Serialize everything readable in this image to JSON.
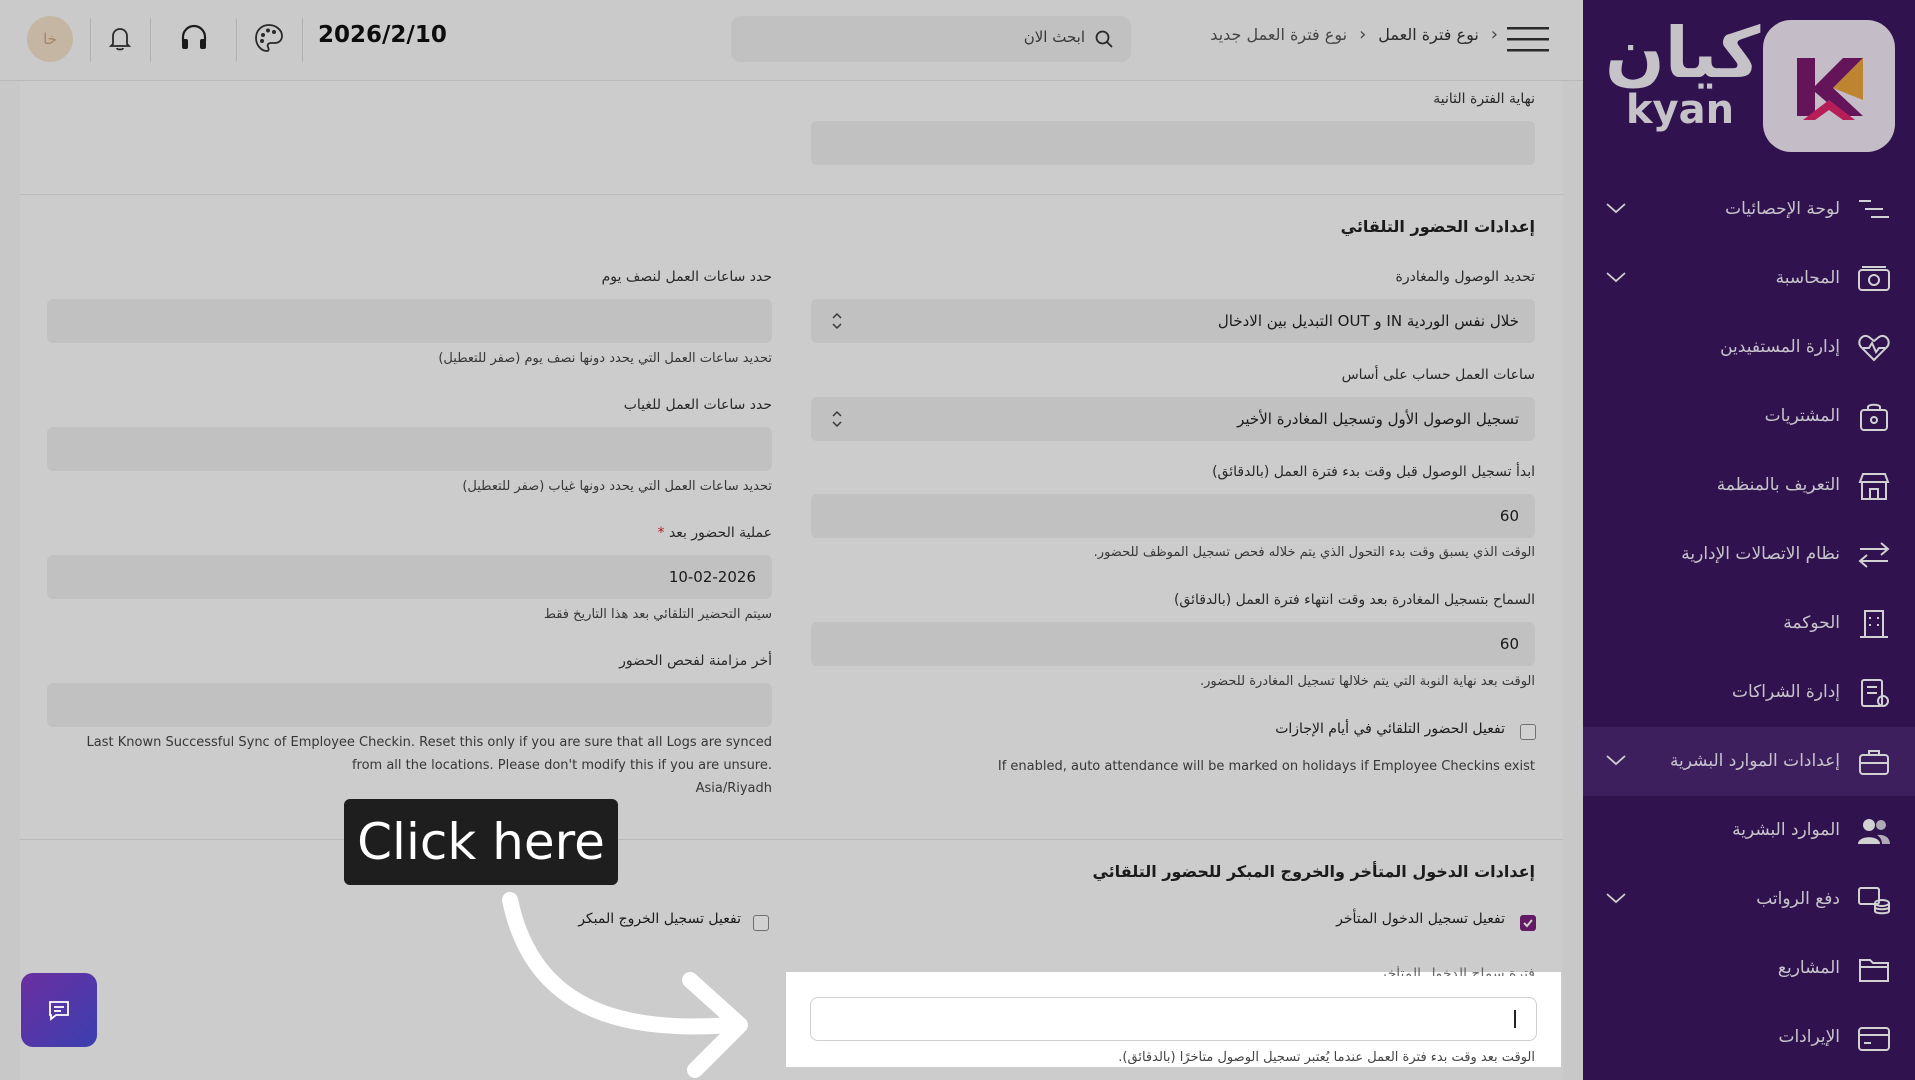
{
  "sidebar": {
    "logo": {
      "arabic": "كيان",
      "english": "kyan"
    },
    "items": [
      {
        "label": "لوحة الإحصائيات",
        "icon": "stats-icon",
        "has_chevron": true
      },
      {
        "label": "المحاسبة",
        "icon": "money-icon",
        "has_chevron": true
      },
      {
        "label": "إدارة المستفيدين",
        "icon": "heart-pulse-icon",
        "has_chevron": false
      },
      {
        "label": "المشتريات",
        "icon": "purchase-box-icon",
        "has_chevron": false
      },
      {
        "label": "التعريف بالمنظمة",
        "icon": "store-icon",
        "has_chevron": false
      },
      {
        "label": "نظام الاتصالات الإدارية",
        "icon": "arrows-exchange-icon",
        "has_chevron": false
      },
      {
        "label": "الحوكمة",
        "icon": "building-icon",
        "has_chevron": false
      },
      {
        "label": "إدارة الشراكات",
        "icon": "document-icon",
        "has_chevron": false
      },
      {
        "label": "إعدادات الموارد البشرية",
        "icon": "briefcase-icon",
        "has_chevron": true,
        "active": true
      },
      {
        "label": "الموارد البشرية",
        "icon": "users-icon",
        "has_chevron": false
      },
      {
        "label": "دفع الرواتب",
        "icon": "coins-icon",
        "has_chevron": true
      },
      {
        "label": "المشاريع",
        "icon": "folder-icon",
        "has_chevron": false
      },
      {
        "label": "الإيرادات",
        "icon": "card-icon",
        "has_chevron": false
      }
    ]
  },
  "header": {
    "breadcrumb": [
      "نوع فترة العمل",
      "نوع فترة العمل جديد"
    ],
    "search_placeholder": "ابحث الان",
    "date": "2026/2/10",
    "avatar_initials": "خا"
  },
  "form": {
    "second_period_end_label": "نهاية الفترة الثانية",
    "auto_attendance_title": "إعدادات الحضور التلقائي",
    "determine_in_out_label": "تحديد الوصول والمغادرة",
    "determine_in_out_value": "خلال نفس الوردية IN و OUT التبديل بين الادخال",
    "working_hours_basis_label": "ساعات العمل حساب على أساس",
    "working_hours_basis_value": "تسجيل الوصول الأول وتسجيل المغادرة الأخير",
    "checkin_before_label": "ابدأ تسجيل الوصول قبل وقت بدء فترة العمل (بالدقائق)",
    "checkin_before_value": "60",
    "checkin_before_hint": "الوقت الذي يسبق وقت بدء التحول الذي يتم خلاله فحص تسجيل الموظف للحضور.",
    "checkout_after_label": "السماح بتسجيل المغادرة بعد وقت انتهاء فترة العمل (بالدقائق)",
    "checkout_after_value": "60",
    "checkout_after_hint": "الوقت بعد نهاية النوبة التي يتم خلالها تسجيل المغادرة للحضور.",
    "holiday_auto_label": "تفعيل الحضور التلقائي في أيام الإجازات",
    "holiday_auto_hint": "If enabled, auto attendance will be marked on holidays if Employee Checkins exist",
    "half_day_label": "حدد ساعات العمل لنصف يوم",
    "half_day_hint": "تحديد ساعات العمل التي يحدد دونها نصف يوم (صفر للتعطيل)",
    "absent_label": "حدد ساعات العمل للغياب",
    "absent_hint": "تحديد ساعات العمل التي يحدد دونها غياب (صفر للتعطيل)",
    "process_after_label": "عملية الحضور بعد",
    "process_after_required": "*",
    "process_after_value": "10-02-2026",
    "process_after_hint": "سيتم التحضير التلقائي بعد هذا التاريخ فقط",
    "last_sync_label": "أخر مزامنة لفحص الحضور",
    "last_sync_hint_1": "Last Known Successful Sync of Employee Checkin. Reset this only if you are sure that all Logs are synced",
    "last_sync_hint_2": "from all the locations. Please don't modify this if you are unsure.",
    "last_sync_hint_3": "Asia/Riyadh",
    "late_early_title": "إعدادات الدخول المتأخر والخروج المبكر للحضور التلقائي",
    "late_entry_label": "تفعيل تسجيل الدخول المتأخر",
    "late_entry_checked": true,
    "early_exit_label": "تفعيل تسجيل الخروج المبكر",
    "early_exit_checked": false,
    "grace_label_cut": "فترة سماح الدخول المتأخر",
    "grace_hint_cut": "الوقت بعد وقت بدء فترة العمل عندما يُعتبر تسجيل الوصول متأخرًا (بالدقائق)."
  },
  "overlay": {
    "tooltip": "Click here"
  },
  "colors": {
    "sidebar_bg": "#3a1660",
    "accent": "#7a1f7a"
  }
}
